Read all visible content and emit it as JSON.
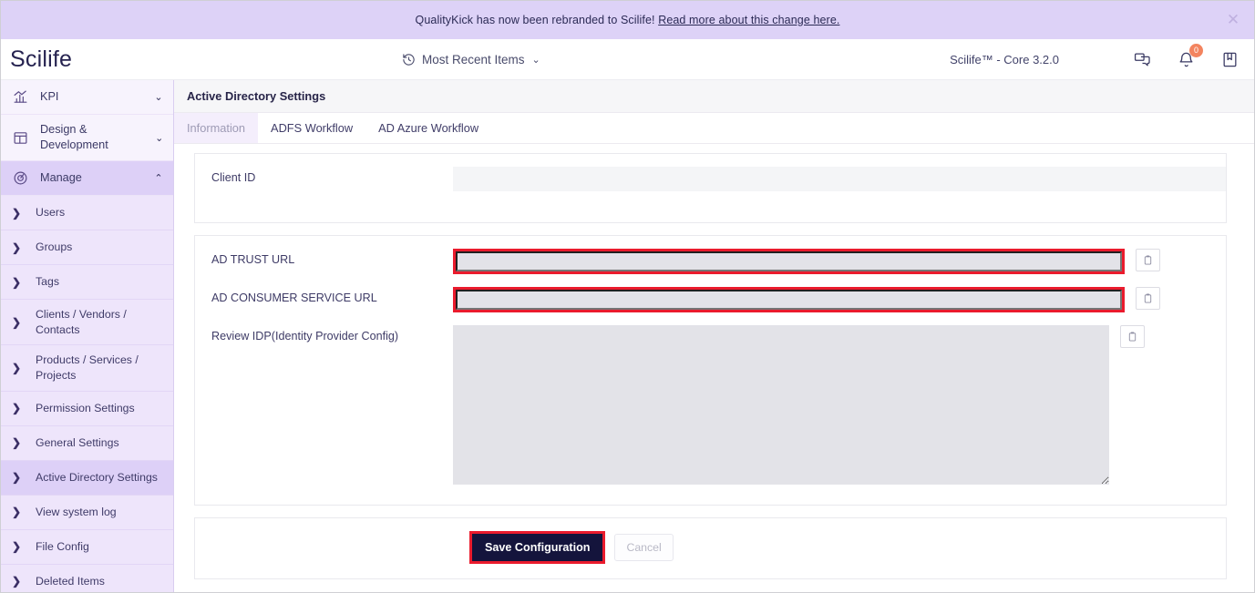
{
  "banner": {
    "text_before": "QualityKick has now been rebranded to Scilife! ",
    "link_text": "Read more about this change here.",
    "close_icon": "close-icon"
  },
  "header": {
    "logo": "Scilife",
    "recent_items_label": "Most Recent Items",
    "recent_items_caret": "⌄",
    "version": "Scilife™ - Core 3.2.0",
    "icons": {
      "chat": "chat-icon",
      "bell": "bell-icon",
      "bell_badge": "0",
      "bookmark": "bookmark-icon"
    }
  },
  "sidebar": {
    "top_items": [
      {
        "label": "KPI",
        "icon": "bar-chart-icon",
        "caret": "⌄",
        "active": false
      },
      {
        "label": "Design & Development",
        "icon": "layout-icon",
        "caret": "⌄",
        "active": false
      },
      {
        "label": "Manage",
        "icon": "target-icon",
        "caret": "⌃",
        "active": true
      }
    ],
    "sub_items": [
      {
        "label": "Users",
        "caret": "❯"
      },
      {
        "label": "Groups",
        "caret": "❯"
      },
      {
        "label": "Tags",
        "caret": "❯"
      },
      {
        "label": "Clients / Vendors / Contacts",
        "caret": "❯"
      },
      {
        "label": "Products / Services / Projects",
        "caret": "❯"
      },
      {
        "label": "Permission Settings",
        "caret": "❯"
      },
      {
        "label": "General Settings",
        "caret": "❯"
      },
      {
        "label": "Active Directory Settings",
        "caret": "❯"
      },
      {
        "label": "View system log",
        "caret": "❯"
      },
      {
        "label": "File Config",
        "caret": "❯"
      },
      {
        "label": "Deleted Items",
        "caret": "❯"
      }
    ],
    "active_sub_item": "Active Directory Settings"
  },
  "main": {
    "page_title": "Active Directory Settings",
    "tabs": [
      {
        "label": "Information",
        "active": true
      },
      {
        "label": "ADFS Workflow",
        "active": false
      },
      {
        "label": "AD Azure Workflow",
        "active": false
      }
    ],
    "fields": {
      "client_id": {
        "label": "Client ID",
        "value": ""
      },
      "ad_trust_url": {
        "label": "AD TRUST URL",
        "value": "",
        "copy_icon": "clipboard-icon"
      },
      "ad_consumer_service_url": {
        "label": "AD CONSUMER SERVICE URL",
        "value": "",
        "copy_icon": "clipboard-icon"
      },
      "review_idp": {
        "label": "Review IDP(Identity Provider Config)",
        "value": "",
        "copy_icon": "clipboard-icon"
      }
    },
    "actions": {
      "save_label": "Save Configuration",
      "cancel_label": "Cancel"
    }
  },
  "colors": {
    "banner_bg": "#ddd2f7",
    "sidebar_bg": "#f7f3fd",
    "sidebar_active": "#ddd0f7",
    "highlight_red": "#ea1b2d",
    "save_navy": "#14143c",
    "badge_orange": "#f3845f"
  }
}
